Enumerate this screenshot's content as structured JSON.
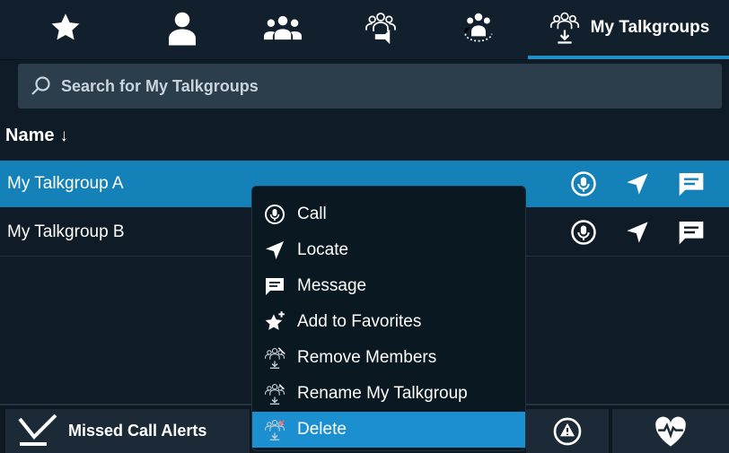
{
  "tabs": [
    {
      "icon": "star-icon",
      "label": ""
    },
    {
      "icon": "person-icon",
      "label": ""
    },
    {
      "icon": "group-icon",
      "label": ""
    },
    {
      "icon": "talkgroup-broadcast-icon",
      "label": ""
    },
    {
      "icon": "talkgroup-scan-icon",
      "label": ""
    },
    {
      "icon": "my-talkgroups-icon",
      "label": "My Talkgroups",
      "active": true
    }
  ],
  "search": {
    "placeholder": "Search for My Talkgroups"
  },
  "list": {
    "header": "Name",
    "sort_indicator": "↓",
    "rows": [
      {
        "name": "My Talkgroup A",
        "selected": true
      },
      {
        "name": "My Talkgroup B",
        "selected": false
      }
    ]
  },
  "context_menu": {
    "items": [
      {
        "label": "Call",
        "icon": "call-icon"
      },
      {
        "label": "Locate",
        "icon": "locate-icon"
      },
      {
        "label": "Message",
        "icon": "message-icon"
      },
      {
        "label": "Add to Favorites",
        "icon": "favorite-add-icon"
      },
      {
        "label": "Remove Members",
        "icon": "remove-members-icon"
      },
      {
        "label": "Rename My Talkgroup",
        "icon": "rename-talkgroup-icon"
      },
      {
        "label": "Delete",
        "icon": "delete-talkgroup-icon",
        "active": true
      }
    ]
  },
  "bottom_bar": {
    "missed_call_alerts": "Missed Call Alerts",
    "icons": [
      "missed-call-check-icon",
      "alert-icon",
      "heartbeat-icon"
    ]
  },
  "colors": {
    "accent": "#1b8fd0",
    "selected_row": "#1481b8",
    "background": "#0f1b26"
  }
}
